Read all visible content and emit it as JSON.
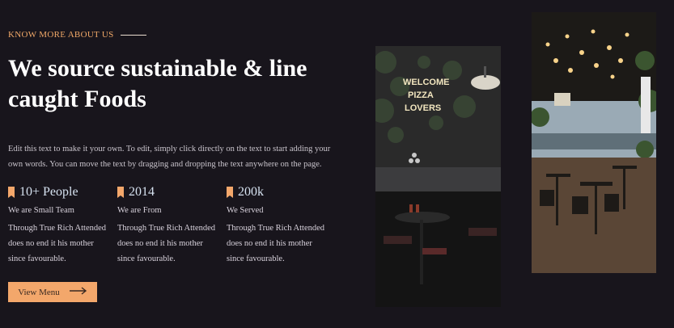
{
  "section": {
    "eyebrow": "KNOW MORE ABOUT US",
    "title_line1": "We source sustainable & line",
    "title_line2": "caught Foods",
    "description": "Edit this text to make it your own. To edit, simply click directly on the text to start adding your own words. You can move the text by dragging and dropping the text anywhere on the page."
  },
  "stats": [
    {
      "icon": "bookmark-icon",
      "value": "10+ People",
      "label": "We are Small Team",
      "text": "Through True Rich Attended does no end it his mother since favourable."
    },
    {
      "icon": "bookmark-icon",
      "value": "2014",
      "label": "We are From",
      "text": "Through True Rich Attended does no end it his mother since favourable."
    },
    {
      "icon": "bookmark-icon",
      "value": "200k",
      "label": "We Served",
      "text": "Through True Rich Attended does no end it his mother since favourable."
    }
  ],
  "button": {
    "label": "View Menu",
    "icon": "arrow-right-icon"
  },
  "photos": [
    {
      "name": "restaurant-bar-photo",
      "sign_text": [
        "WELCOME",
        "PIZZA",
        "LOVERS"
      ]
    },
    {
      "name": "restaurant-dining-photo"
    }
  ],
  "colors": {
    "accent": "#f3a76b",
    "background": "#18151c"
  }
}
